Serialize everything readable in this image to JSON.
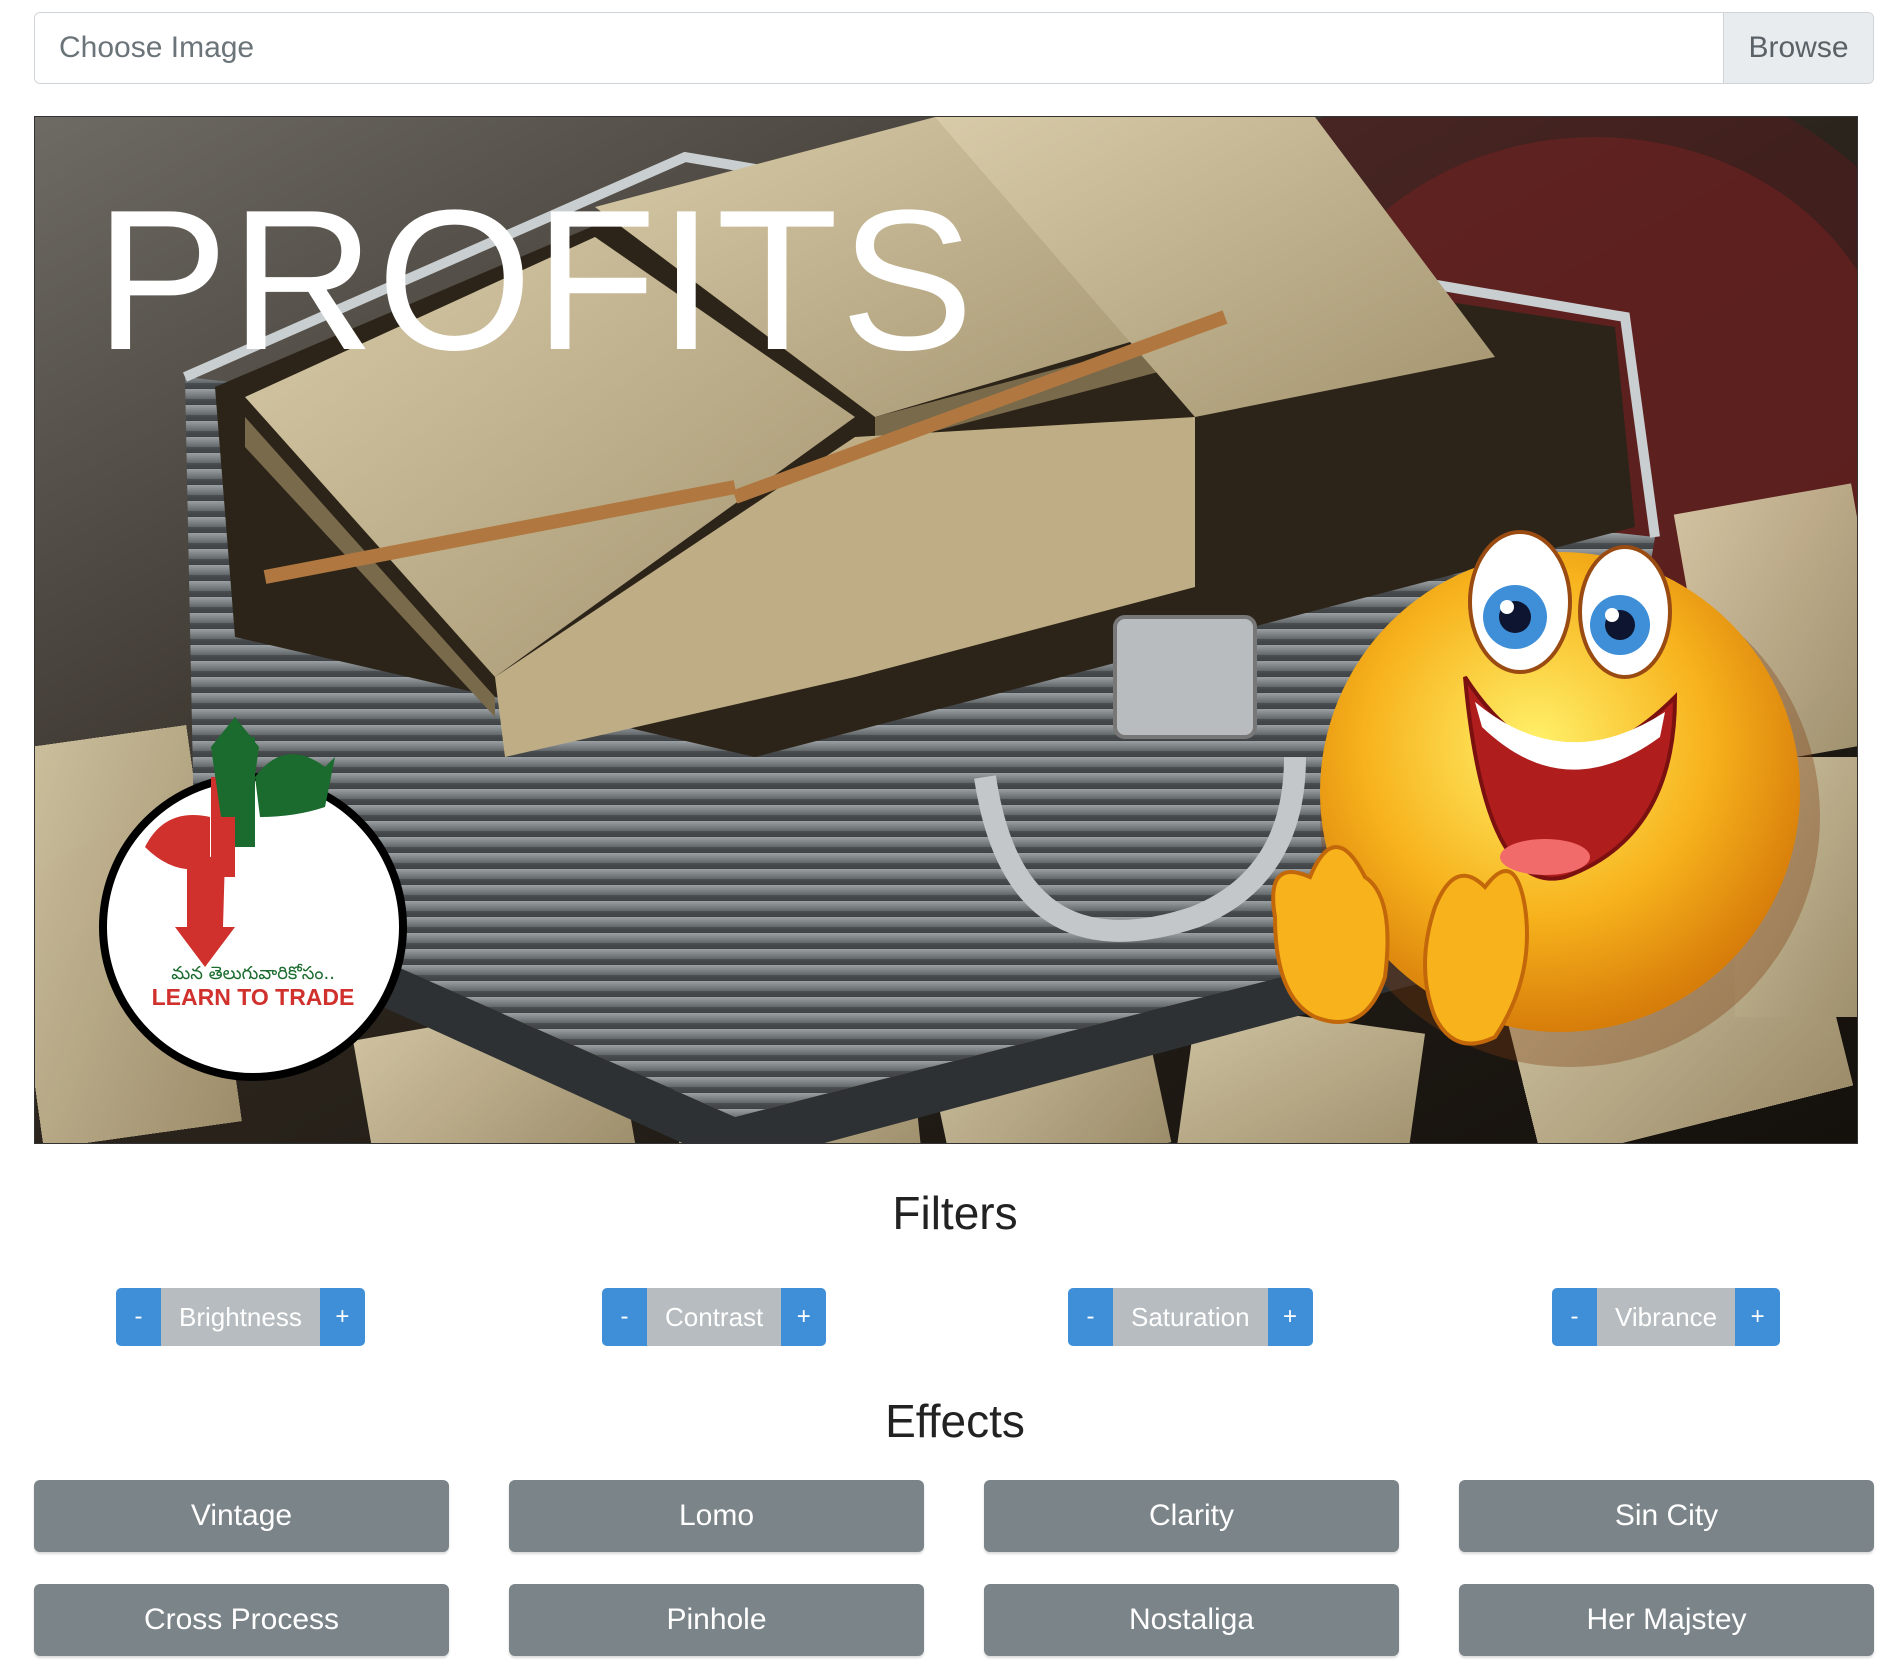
{
  "file_chooser": {
    "placeholder": "Choose Image",
    "browse_label": "Browse"
  },
  "image": {
    "overlay_text": "PROFITS",
    "logo_telugu_text": "మన తెలుగువారికోసం..",
    "logo_text": "LEARN TO TRADE"
  },
  "filters": {
    "title": "Filters",
    "items": [
      {
        "label": "Brightness",
        "minus": "-",
        "plus": "+"
      },
      {
        "label": "Contrast",
        "minus": "-",
        "plus": "+"
      },
      {
        "label": "Saturation",
        "minus": "-",
        "plus": "+"
      },
      {
        "label": "Vibrance",
        "minus": "-",
        "plus": "+"
      }
    ]
  },
  "effects": {
    "title": "Effects",
    "items": [
      "Vintage",
      "Lomo",
      "Clarity",
      "Sin City",
      "Cross Process",
      "Pinhole",
      "Nostaliga",
      "Her Majstey"
    ]
  },
  "colors": {
    "filter_button": "#3f8fd8",
    "filter_label_bg": "#b6bcbf",
    "effect_button": "#7b8489"
  }
}
